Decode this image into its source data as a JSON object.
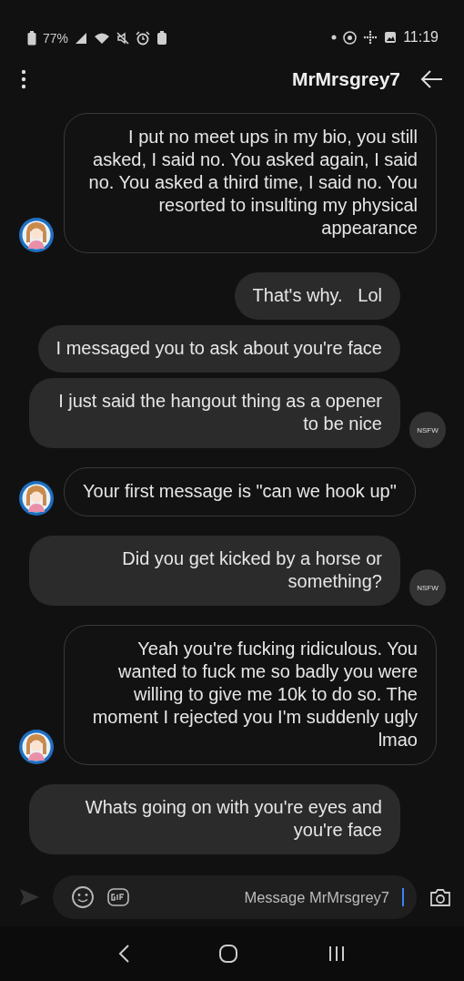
{
  "status_bar": {
    "time": "11:19",
    "battery": "77%"
  },
  "header": {
    "title": "MrMrsgrey7"
  },
  "messages": [
    {
      "kind": "received",
      "text": "I put no meet ups in my bio, you still asked, I said no. You asked again, I said no. You asked a third time, I said no. You resorted to insulting my physical appearance",
      "avatar": true
    },
    {
      "kind": "sent",
      "text": "That's why.   Lol",
      "avatar": false
    },
    {
      "kind": "sent",
      "text": "I messaged you to ask about you're face",
      "avatar": false
    },
    {
      "kind": "sent",
      "text": "I just said the hangout thing as a opener to be nice",
      "avatar": true,
      "avatar_label": "NSFW"
    },
    {
      "kind": "received",
      "text": "Your first message is \"can we hook up\"",
      "avatar": true
    },
    {
      "kind": "sent",
      "text": "Did you get kicked by a horse or something?",
      "avatar": true,
      "avatar_label": "NSFW"
    },
    {
      "kind": "received",
      "text": "Yeah you're fucking ridiculous. You wanted to fuck me so badly you were willing to give me 10k to do so. The moment I rejected you I'm suddenly ugly lmao",
      "avatar": true
    },
    {
      "kind": "sent",
      "text": "Whats going on with you're eyes and you're face",
      "avatar": false
    }
  ],
  "composer": {
    "placeholder": "Message MrMrsgrey7"
  }
}
